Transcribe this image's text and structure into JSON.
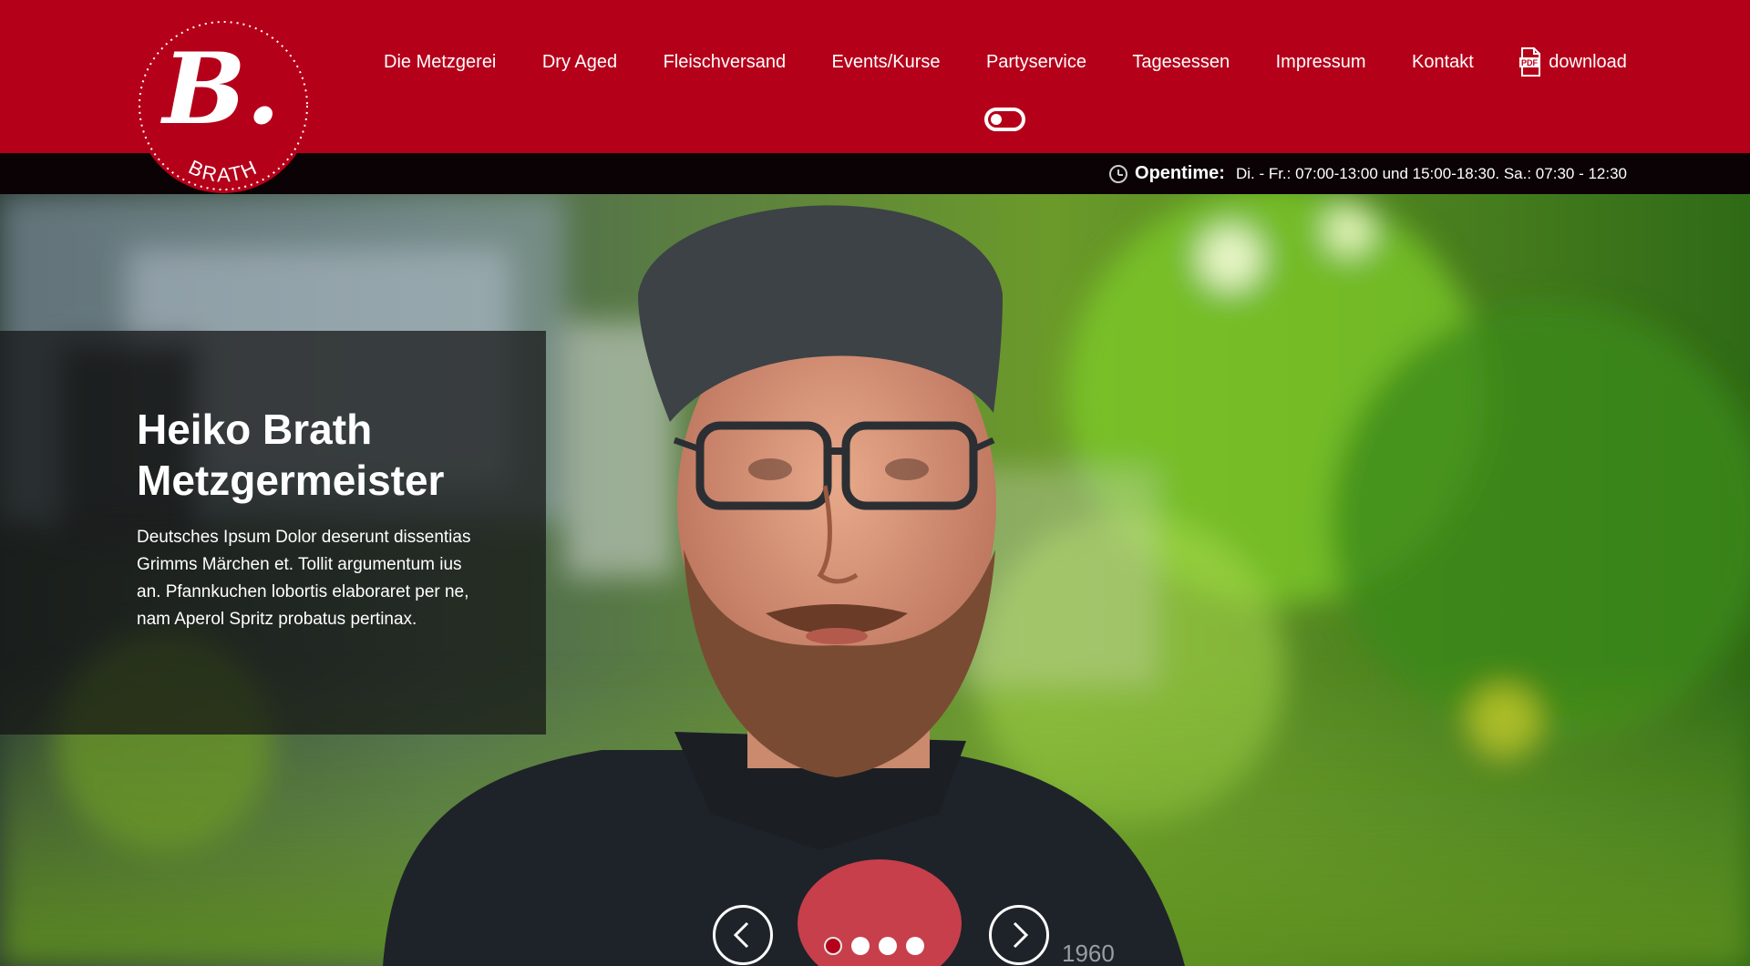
{
  "brand": {
    "logo_letter": "B.",
    "logo_word": "BRATH",
    "accent_color": "#b5001a"
  },
  "nav": {
    "items": [
      {
        "label": "Die Metzgerei"
      },
      {
        "label": "Dry Aged"
      },
      {
        "label": "Fleischversand"
      },
      {
        "label": "Events/Kurse"
      },
      {
        "label": "Partyservice"
      },
      {
        "label": "Tagesessen"
      },
      {
        "label": "Impressum"
      },
      {
        "label": "Kontakt"
      }
    ],
    "download_label": "download",
    "download_icon": "pdf-icon",
    "pdf_badge": "PDF"
  },
  "theme_toggle": {
    "icon": "toggle-icon",
    "state": "off"
  },
  "opentime": {
    "label": "Opentime:",
    "text": "Di. - Fr.: 07:00-13:00 und 15:00-18:30. Sa.: 07:30 - 12:30",
    "icon": "clock-icon"
  },
  "hero": {
    "title_line1": "Heiko Brath",
    "title_line2": "Metzgermeister",
    "text": "Deutsches Ipsum Dolor deserunt dissentias Grimms Märchen et. Tollit argumentum ius an. Pfannkuchen lobortis elaboraret per ne, nam Aperol Spritz probatus pertinax.",
    "slide_count": 4,
    "active_slide": 1,
    "shirt_text": "1960"
  }
}
